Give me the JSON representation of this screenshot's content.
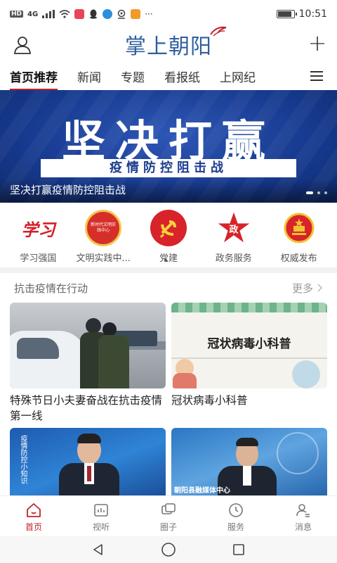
{
  "status_bar": {
    "time": "10:51",
    "network": "4G",
    "hd": "HD",
    "more": "···",
    "battery_level": 0.9
  },
  "header": {
    "app_title": "掌上朝阳",
    "user_icon": "user-icon",
    "add_icon": "plus-icon"
  },
  "tabs": [
    {
      "label": "首页推荐",
      "active": true
    },
    {
      "label": "新闻"
    },
    {
      "label": "专题"
    },
    {
      "label": "看报纸"
    },
    {
      "label": "上网纪"
    }
  ],
  "banner": {
    "headline": "坚决打赢",
    "subline": "疫情防控阻击战",
    "caption": "坚决打赢疫情防控阻击战",
    "slide_count": 3,
    "active_slide": 1
  },
  "quick_links": [
    {
      "label": "学习强国",
      "icon": "xuexi-logo-icon",
      "icon_text": "学习"
    },
    {
      "label": "文明实践中...",
      "icon": "civilization-center-icon",
      "icon_text": "新时代文明实践中心"
    },
    {
      "label": "党建",
      "icon": "party-emblem-icon"
    },
    {
      "label": "政务服务",
      "icon": "government-star-icon",
      "icon_text": "政"
    },
    {
      "label": "权威发布",
      "icon": "national-emblem-icon"
    }
  ],
  "quick_pager": {
    "pages": 2,
    "active": 1
  },
  "section": {
    "title": "抗击疫情在行动",
    "more": "更多"
  },
  "articles": [
    {
      "title": "特殊节日小夫妻奋战在抗击疫情第一线",
      "image": "checkpoint-photo"
    },
    {
      "title": "冠状病毒小科普",
      "image": "science-poster",
      "image_text": "冠状病毒小科普"
    },
    {
      "title": "",
      "image": "news-anchor-photo",
      "image_text": "疫情防控小知识"
    },
    {
      "title": "",
      "image": "news-anchor-photo-2",
      "image_text": "朝阳县融媒体中心"
    }
  ],
  "bottom_nav": [
    {
      "label": "首页",
      "icon": "home-icon",
      "active": true
    },
    {
      "label": "视听",
      "icon": "video-icon"
    },
    {
      "label": "圈子",
      "icon": "circle-icon"
    },
    {
      "label": "服务",
      "icon": "clock-icon"
    },
    {
      "label": "消息",
      "icon": "message-user-icon"
    }
  ],
  "colors": {
    "accent": "#c0232c",
    "logo_blue": "#2f5f9e",
    "banner_blue": "#173a8f"
  }
}
